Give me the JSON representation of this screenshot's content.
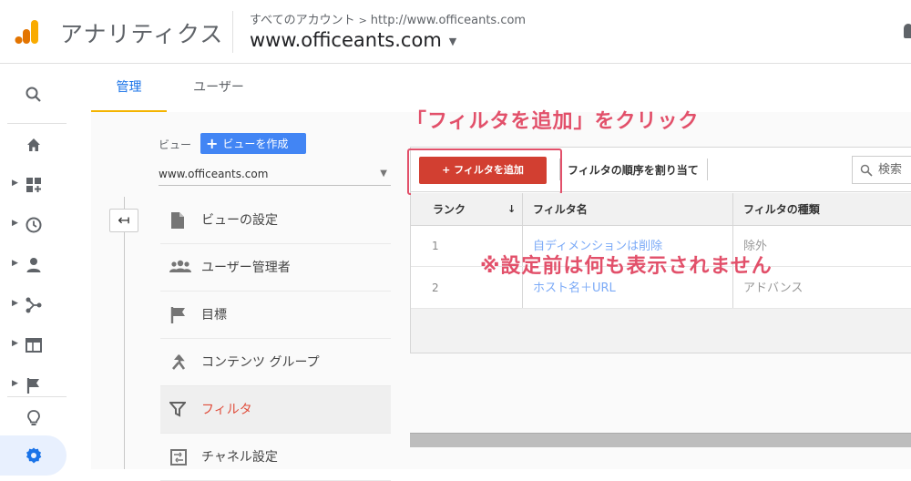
{
  "header": {
    "app_title": "アナリティクス",
    "breadcrumb_account": "すべてのアカウント",
    "breadcrumb_separator": ">",
    "breadcrumb_property": "http://www.officeants.com",
    "property_name": "www.officeants.com"
  },
  "tabs": [
    {
      "label": "管理",
      "active": true
    },
    {
      "label": "ユーザー",
      "active": false
    }
  ],
  "view": {
    "label": "ビュー",
    "create_button": "ビューを作成",
    "selected": "www.officeants.com"
  },
  "menu": [
    {
      "label": "ビューの設定",
      "icon": "document-icon"
    },
    {
      "label": "ユーザー管理者",
      "icon": "people-icon"
    },
    {
      "label": "目標",
      "icon": "flag-icon"
    },
    {
      "label": "コンテンツ グループ",
      "icon": "content-group-icon"
    },
    {
      "label": "フィルタ",
      "icon": "filter-icon",
      "active": true
    },
    {
      "label": "チャネル設定",
      "icon": "channel-icon"
    }
  ],
  "annotations": {
    "top": "「フィルタを追加」をクリック",
    "middle": "※設定前は何も表示されません"
  },
  "toolbar": {
    "add_filter": "+ フィルタを追加",
    "assign_order": "フィルタの順序を割り当て",
    "search_placeholder": "検索"
  },
  "table": {
    "columns": [
      "ランク",
      "フィルタ名",
      "フィルタの種類"
    ],
    "rows": [
      {
        "rank": "1",
        "name": "自ディメンションは削除",
        "type": "除外"
      },
      {
        "rank": "2",
        "name": "ホスト名＋URL",
        "type": "アドバンス"
      }
    ]
  },
  "colors": {
    "accent_blue": "#1a73e8",
    "add_button_red": "#d23f31",
    "annotation_pink": "#e2506a",
    "tab_underline": "#f4b400"
  }
}
